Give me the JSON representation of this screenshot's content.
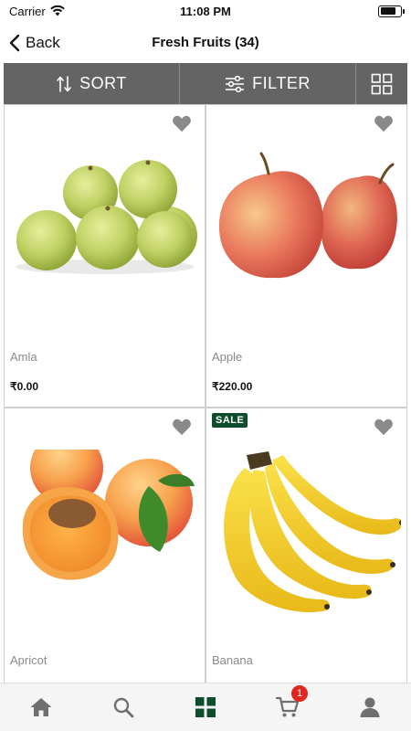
{
  "status_bar": {
    "carrier": "Carrier",
    "time": "11:08 PM",
    "battery_level": 0.8
  },
  "nav": {
    "back_label": "Back",
    "title": "Fresh Fruits (34)"
  },
  "toolbar": {
    "sort_label": "SORT",
    "filter_label": "FILTER",
    "sort_icon": "sort-arrows-icon",
    "filter_icon": "sliders-icon",
    "view_icon": "grid-view-icon",
    "background_color": "#646464"
  },
  "products": [
    {
      "name": "Amla",
      "price": "₹0.00",
      "sale_label": ""
    },
    {
      "name": "Apple",
      "price": "₹220.00",
      "sale_label": ""
    },
    {
      "name": "Apricot",
      "price": "",
      "sale_label": ""
    },
    {
      "name": "Banana",
      "price": "",
      "sale_label": "SALE"
    }
  ],
  "tab_bar": {
    "items": [
      {
        "icon": "home-icon"
      },
      {
        "icon": "search-icon"
      },
      {
        "icon": "categories-icon",
        "active": true
      },
      {
        "icon": "cart-icon",
        "badge": "1"
      },
      {
        "icon": "profile-icon"
      }
    ],
    "active_color": "#0e4d2c",
    "inactive_color": "#6f6f6f",
    "badge_color": "#e0261f"
  }
}
